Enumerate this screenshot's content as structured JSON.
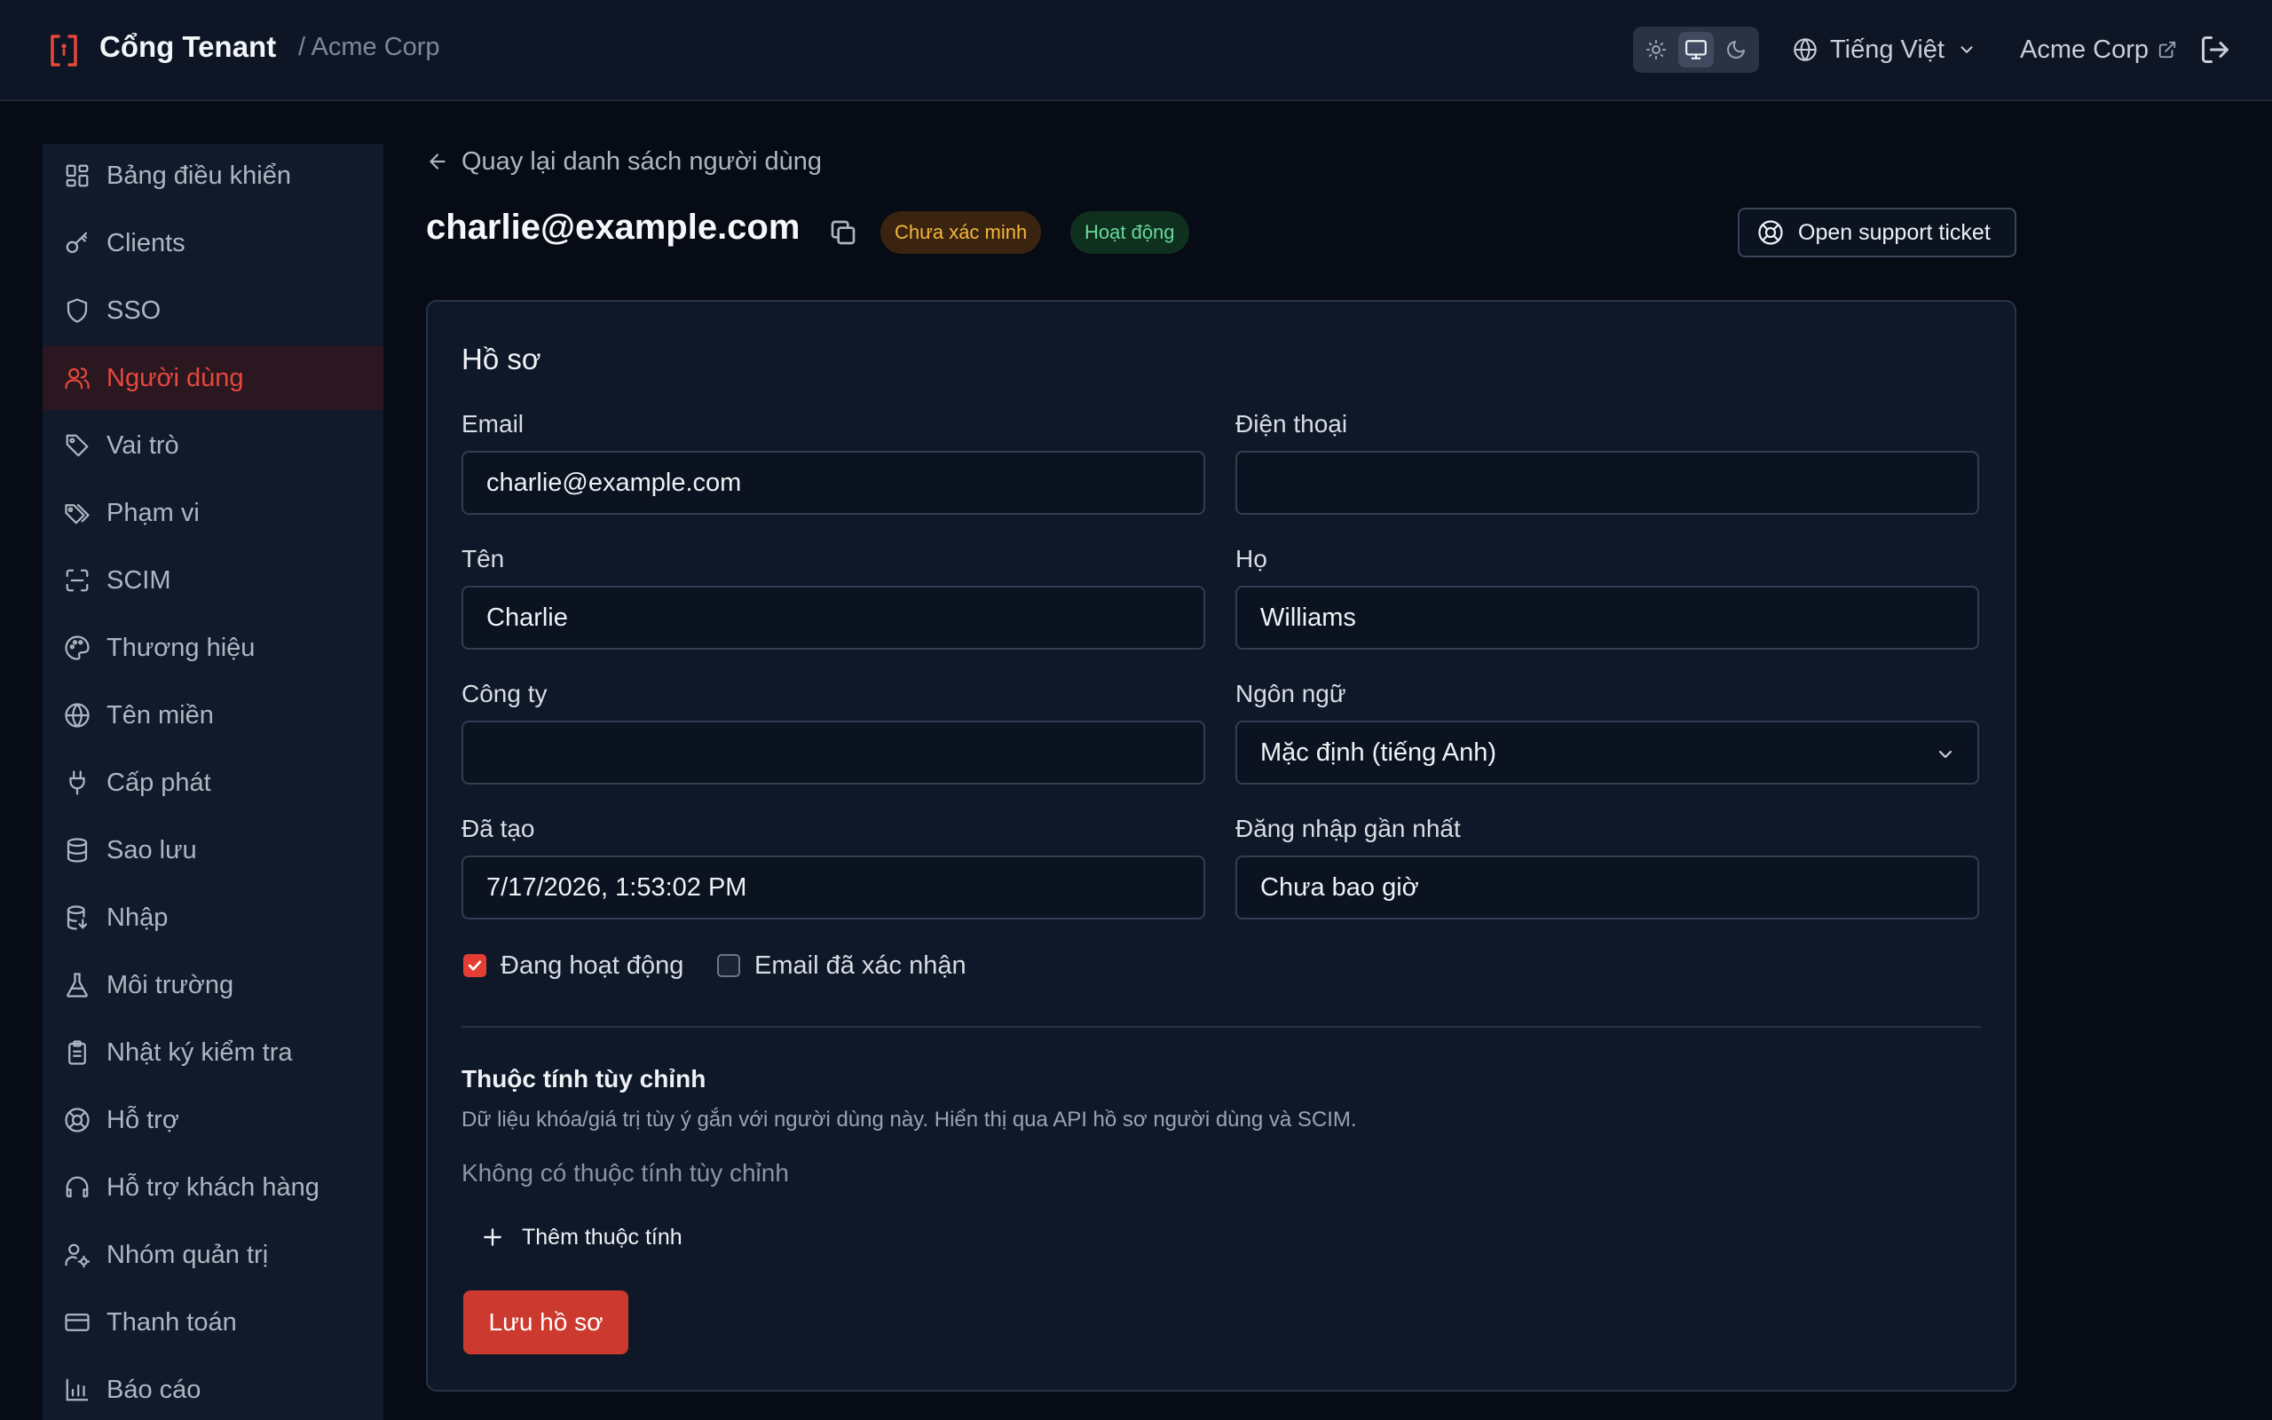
{
  "header": {
    "app_title": "Cổng Tenant",
    "tenant_crumb": "/ Acme Corp",
    "theme_modes": [
      "light",
      "system",
      "dark"
    ],
    "active_theme": "system",
    "language": "Tiếng Việt",
    "tenant_name": "Acme Corp",
    "brand_color": "#e5483c"
  },
  "sidebar": {
    "items": [
      {
        "label": "Bảng điều khiển",
        "icon": "dashboard-icon"
      },
      {
        "label": "Clients",
        "icon": "key-icon"
      },
      {
        "label": "SSO",
        "icon": "shield-icon"
      },
      {
        "label": "Người dùng",
        "icon": "users-icon",
        "active": true
      },
      {
        "label": "Vai trò",
        "icon": "tag-icon"
      },
      {
        "label": "Phạm vi",
        "icon": "tags-icon"
      },
      {
        "label": "SCIM",
        "icon": "scan-icon"
      },
      {
        "label": "Thương hiệu",
        "icon": "palette-icon"
      },
      {
        "label": "Tên miền",
        "icon": "globe-icon"
      },
      {
        "label": "Cấp phát",
        "icon": "plug-icon"
      },
      {
        "label": "Sao lưu",
        "icon": "database-icon"
      },
      {
        "label": "Nhập",
        "icon": "database-import-icon"
      },
      {
        "label": "Môi trường",
        "icon": "flask-icon"
      },
      {
        "label": "Nhật ký kiểm tra",
        "icon": "clipboard-icon"
      },
      {
        "label": "Hỗ trợ",
        "icon": "lifebuoy-icon"
      },
      {
        "label": "Hỗ trợ khách hàng",
        "icon": "headset-icon"
      },
      {
        "label": "Nhóm quản trị",
        "icon": "user-cog-icon"
      },
      {
        "label": "Thanh toán",
        "icon": "credit-card-icon"
      },
      {
        "label": "Báo cáo",
        "icon": "bar-chart-icon"
      }
    ]
  },
  "main": {
    "back_link": "Quay lại danh sách người dùng",
    "title": "charlie@example.com",
    "badges": {
      "unverified": "Chưa xác minh",
      "active": "Hoạt động"
    },
    "support_button": "Open support ticket",
    "profile": {
      "section_title": "Hồ sơ",
      "email_label": "Email",
      "email_value": "charlie@example.com",
      "phone_label": "Điện thoại",
      "phone_value": "",
      "first_name_label": "Tên",
      "first_name_value": "Charlie",
      "last_name_label": "Họ",
      "last_name_value": "Williams",
      "company_label": "Công ty",
      "company_value": "",
      "language_label": "Ngôn ngữ",
      "language_value": "Mặc định (tiếng Anh)",
      "created_label": "Đã tạo",
      "created_value": "7/17/2026, 1:53:02 PM",
      "last_login_label": "Đăng nhập gần nhất",
      "last_login_value": "Chưa bao giờ",
      "active_checkbox": {
        "label": "Đang hoạt động",
        "checked": true
      },
      "email_verified_checkbox": {
        "label": "Email đã xác nhận",
        "checked": false
      }
    },
    "custom_attributes": {
      "title": "Thuộc tính tùy chỉnh",
      "description": "Dữ liệu khóa/giá trị tùy ý gắn với người dùng này. Hiển thị qua API hồ sơ người dùng và SCIM.",
      "empty_text": "Không có thuộc tính tùy chỉnh",
      "add_button": "Thêm thuộc tính"
    },
    "save_button": "Lưu hồ sơ"
  }
}
